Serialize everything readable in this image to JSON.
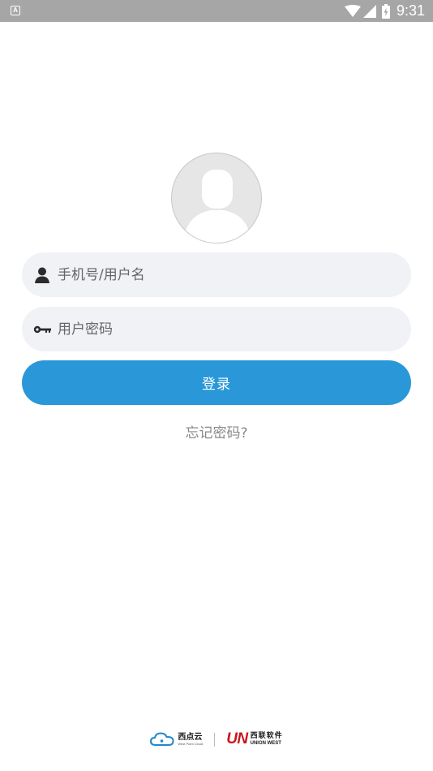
{
  "status_bar": {
    "notification_icon": "A",
    "time": "9:31",
    "icons": [
      "wifi-icon",
      "cell-signal-icon",
      "battery-icon"
    ]
  },
  "avatar": {
    "icon": "default-avatar-icon"
  },
  "login_form": {
    "username": {
      "placeholder": "手机号/用户名",
      "value": "",
      "icon": "user-icon"
    },
    "password": {
      "placeholder": "用户密码",
      "value": "",
      "icon": "key-icon"
    },
    "submit_label": "登录",
    "forgot_label": "忘记密码?"
  },
  "footer": {
    "brand1": {
      "name_cn": "西点云",
      "name_en": "West Point Cloud",
      "icon": "cloud-icon"
    },
    "brand2": {
      "logo": "UN",
      "name_cn": "西联软件",
      "name_en": "UNION WEST"
    }
  },
  "colors": {
    "primary": "#2a98d8",
    "field_bg": "#f0f2f6",
    "status_bar": "#a6a6a6",
    "brand_red": "#c8161d",
    "cloud_blue": "#1e88c8"
  }
}
